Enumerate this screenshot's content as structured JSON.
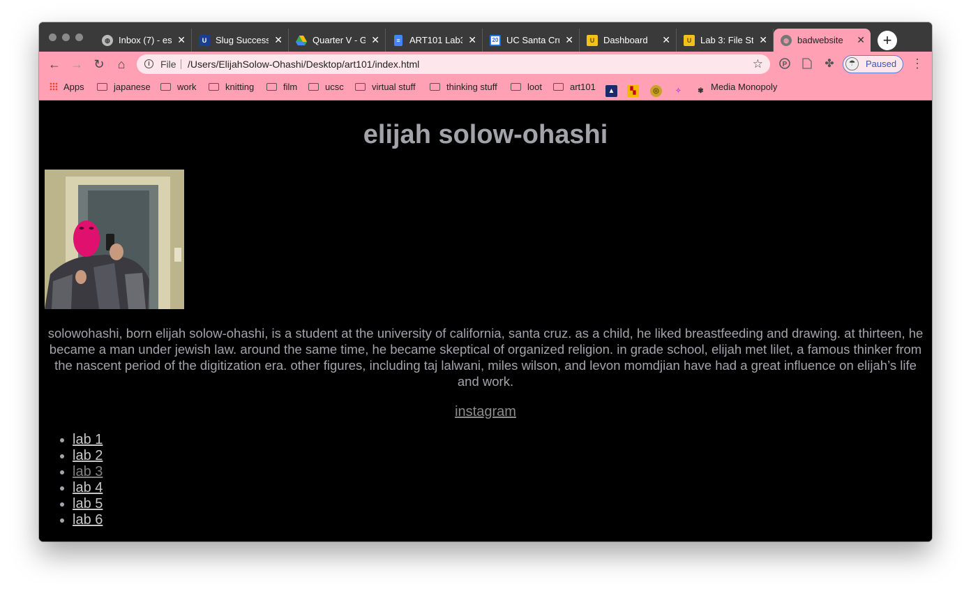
{
  "tabs": [
    {
      "title": "Inbox (7) - es",
      "favicon": "globe-icon",
      "active": false
    },
    {
      "title": "Slug Success",
      "favicon": "ucsc-icon",
      "active": false
    },
    {
      "title": "Quarter V - G",
      "favicon": "drive-icon",
      "active": false
    },
    {
      "title": "ART101 Lab3",
      "favicon": "docs-icon",
      "active": false
    },
    {
      "title": "UC Santa Cru",
      "favicon": "calendar-icon",
      "active": false
    },
    {
      "title": "Dashboard",
      "favicon": "ucsc-icon",
      "active": false
    },
    {
      "title": "Lab 3: File St",
      "favicon": "ucsc-icon",
      "active": false
    },
    {
      "title": "badwebsite",
      "favicon": "globe-icon",
      "active": true
    }
  ],
  "omnibox": {
    "scheme": "File",
    "url": "/Users/ElijahSolow-Ohashi/Desktop/art101/index.html"
  },
  "profile": {
    "label": "Paused"
  },
  "bookmarks": [
    {
      "label": "Apps",
      "type": "apps"
    },
    {
      "label": "japanese",
      "type": "folder"
    },
    {
      "label": "work",
      "type": "folder"
    },
    {
      "label": "knitting",
      "type": "folder"
    },
    {
      "label": "film",
      "type": "folder"
    },
    {
      "label": "ucsc",
      "type": "folder"
    },
    {
      "label": "virtual stuff",
      "type": "folder"
    },
    {
      "label": "thinking stuff",
      "type": "folder"
    },
    {
      "label": "loot",
      "type": "folder"
    },
    {
      "label": "art101",
      "type": "folder"
    },
    {
      "label": "Media Monopoly",
      "type": "site"
    }
  ],
  "page": {
    "title": "elijah solow-ohashi",
    "bio": "solowohashi, born elijah solow-ohashi, is a student at the university of california, santa cruz. as a child, he liked breastfeeding and drawing. at thirteen, he became a man under jewish law. around the same time, he became skeptical of organized religion. in grade school, elijah met lilet, a famous thinker from the nascent period of the digitization era. other figures, including taj lalwani, miles wilson, and levon momdjian have had a great influence on elijah’s life and work.",
    "instagram_label": "instagram",
    "labs": [
      "lab 1",
      "lab 2",
      "lab 3",
      "lab 4",
      "lab 5",
      "lab 6"
    ]
  },
  "colors": {
    "chrome_accent": "#ffa0b4",
    "tabstrip": "#3a3a3a",
    "page_bg": "#000000",
    "page_text": "#a3a3aa"
  }
}
